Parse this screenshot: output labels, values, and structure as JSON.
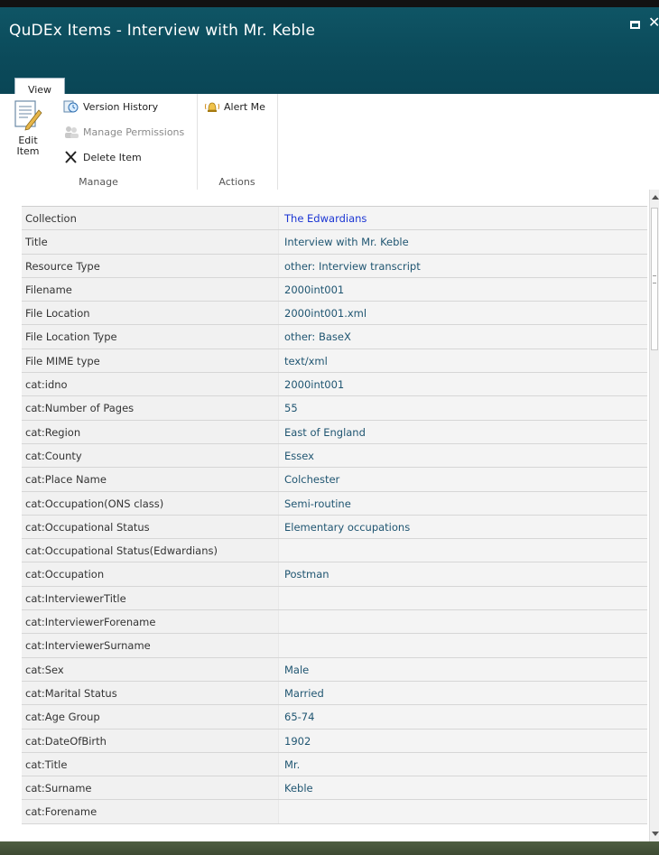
{
  "window": {
    "title": "QuDEx Items - Interview with Mr. Keble",
    "maximize_icon": "maximize-icon",
    "close_glyph": "✕"
  },
  "ribbon": {
    "tab": "View",
    "manage_group": {
      "label": "Manage",
      "edit_label_1": "Edit",
      "edit_label_2": "Item",
      "version_history": "Version History",
      "manage_permissions": "Manage Permissions",
      "delete_item": "Delete Item"
    },
    "actions_group": {
      "label": "Actions",
      "alert_me": "Alert Me"
    }
  },
  "properties": [
    {
      "label": "Collection",
      "value": "The Edwardians",
      "is_link": true
    },
    {
      "label": "Title",
      "value": "Interview with Mr. Keble"
    },
    {
      "label": "Resource Type",
      "value": "other: Interview transcript"
    },
    {
      "label": "Filename",
      "value": "2000int001"
    },
    {
      "label": "File Location",
      "value": "2000int001.xml"
    },
    {
      "label": "File Location Type",
      "value": "other: BaseX"
    },
    {
      "label": "File MIME type",
      "value": "text/xml"
    },
    {
      "label": "cat:idno",
      "value": "2000int001"
    },
    {
      "label": "cat:Number of Pages",
      "value": "55"
    },
    {
      "label": "cat:Region",
      "value": "East of England"
    },
    {
      "label": "cat:County",
      "value": "Essex"
    },
    {
      "label": "cat:Place Name",
      "value": "Colchester"
    },
    {
      "label": "cat:Occupation(ONS class)",
      "value": "Semi-routine"
    },
    {
      "label": "cat:Occupational Status",
      "value": "Elementary occupations"
    },
    {
      "label": "cat:Occupational Status(Edwardians)",
      "value": ""
    },
    {
      "label": "cat:Occupation",
      "value": "Postman"
    },
    {
      "label": "cat:InterviewerTitle",
      "value": ""
    },
    {
      "label": "cat:InterviewerForename",
      "value": ""
    },
    {
      "label": "cat:InterviewerSurname",
      "value": ""
    },
    {
      "label": "cat:Sex",
      "value": "Male"
    },
    {
      "label": "cat:Marital Status",
      "value": "Married"
    },
    {
      "label": "cat:Age Group",
      "value": "65-74"
    },
    {
      "label": "cat:DateOfBirth",
      "value": "1902"
    },
    {
      "label": "cat:Title",
      "value": "Mr."
    },
    {
      "label": "cat:Surname",
      "value": "Keble"
    },
    {
      "label": "cat:Forename",
      "value": ""
    }
  ]
}
